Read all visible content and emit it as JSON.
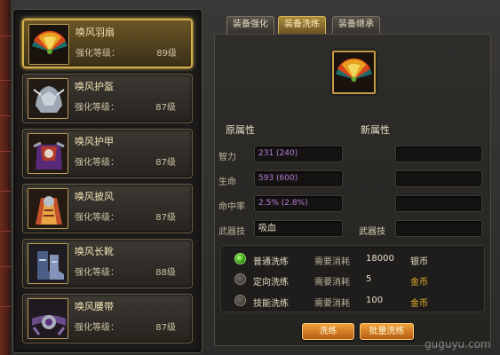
{
  "colors": {
    "accent_gold": "#d8b14a",
    "silver": "#e8e0cc",
    "gold_currency": "#e7b52a",
    "purple_value": "#b87bd6"
  },
  "items": [
    {
      "name": "唤风羽扇",
      "level_label": "强化等级：",
      "level": "89级",
      "icon": "feather-fan-icon",
      "selected": true
    },
    {
      "name": "唤风护盔",
      "level_label": "强化等级：",
      "level": "87级",
      "icon": "helmet-icon",
      "selected": false
    },
    {
      "name": "唤风护甲",
      "level_label": "强化等级：",
      "level": "87级",
      "icon": "armor-icon",
      "selected": false
    },
    {
      "name": "唤风披风",
      "level_label": "强化等级：",
      "level": "87级",
      "icon": "cloak-icon",
      "selected": false
    },
    {
      "name": "唤风长靴",
      "level_label": "强化等级：",
      "level": "88级",
      "icon": "boots-icon",
      "selected": false
    },
    {
      "name": "唤风腰带",
      "level_label": "强化等级：",
      "level": "87级",
      "icon": "belt-icon",
      "selected": false
    }
  ],
  "tabs": [
    {
      "label": "装备强化",
      "active": false
    },
    {
      "label": "装备洗练",
      "active": true
    },
    {
      "label": "装备继承",
      "active": false
    }
  ],
  "attributes": {
    "original_title": "原属性",
    "new_title": "新属性",
    "rows": [
      {
        "label": "智力",
        "original": "231 (240)",
        "new": ""
      },
      {
        "label": "生命",
        "original": "593 (600)",
        "new": ""
      },
      {
        "label": "命中率",
        "original": "2.5% (2.8%)",
        "new": ""
      }
    ],
    "weapon_skill": {
      "label": "武器技",
      "original": "吸血",
      "new_label": "武器技",
      "new": ""
    }
  },
  "wash_options": [
    {
      "label": "普通洗练",
      "selected": true,
      "cost_label": "需要消耗",
      "amount": "18000",
      "currency": "银币"
    },
    {
      "label": "定向洗练",
      "selected": false,
      "cost_label": "需要消耗",
      "amount": "5",
      "currency": "金币"
    },
    {
      "label": "技能洗练",
      "selected": false,
      "cost_label": "需要消耗",
      "amount": "100",
      "currency": "金币"
    }
  ],
  "buttons": {
    "wash": "洗练",
    "batch_wash": "批量洗练"
  },
  "watermark": "guguyu.com"
}
